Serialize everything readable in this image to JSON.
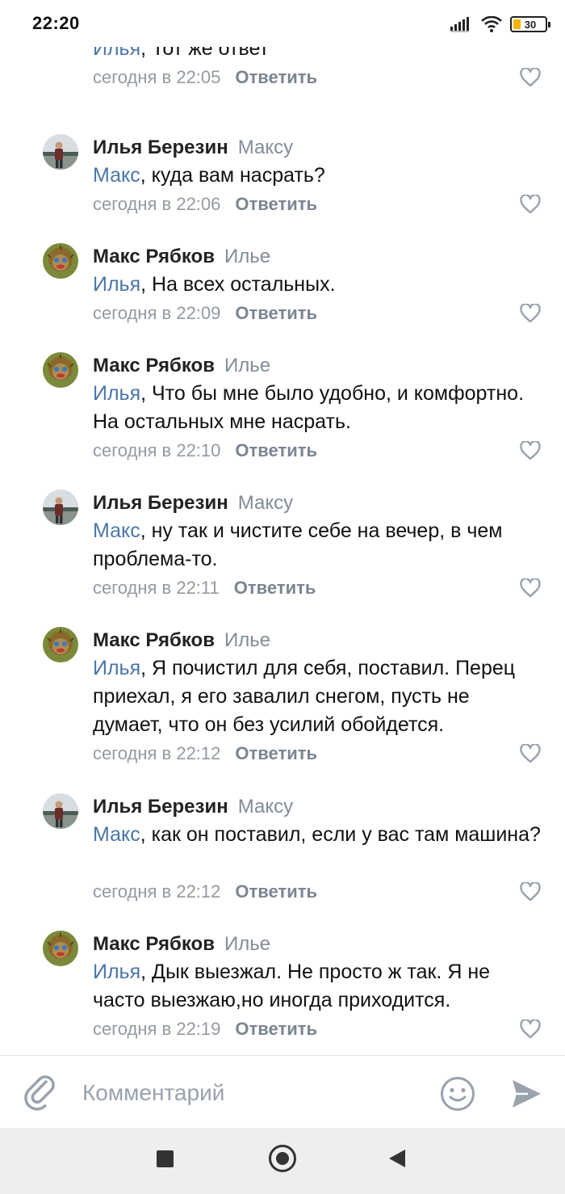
{
  "status_bar": {
    "time": "22:20",
    "battery": "30",
    "icons": [
      "signal-icon",
      "wifi-icon",
      "battery-icon"
    ]
  },
  "colors": {
    "mention": "#4a76a8",
    "secondary": "#818c99",
    "battery_fill": "#f5b400"
  },
  "comments": [
    {
      "author": "",
      "reply_to": "",
      "mention": "Илья",
      "text": ", Тот же ответ",
      "date": "сегодня в 22:05",
      "reply_label": "Ответить",
      "avatar": "maks"
    },
    {
      "author": "Илья Березин",
      "reply_to": "Максу",
      "mention": "Макс",
      "text": ", куда вам насрать?",
      "date": "сегодня в 22:06",
      "reply_label": "Ответить",
      "avatar": "ilya"
    },
    {
      "author": "Макс Рябков",
      "reply_to": "Илье",
      "mention": "Илья",
      "text": ", На всех остальных.",
      "date": "сегодня в 22:09",
      "reply_label": "Ответить",
      "avatar": "maks"
    },
    {
      "author": "Макс Рябков",
      "reply_to": "Илье",
      "mention": "Илья",
      "text": ", Что бы мне было удобно, и комфортно. На остальных мне насрать.",
      "date": "сегодня в 22:10",
      "reply_label": "Ответить",
      "avatar": "maks"
    },
    {
      "author": "Илья Березин",
      "reply_to": "Максу",
      "mention": "Макс",
      "text": ", ну так и чистите себе на вечер, в чем проблема-то.",
      "date": "сегодня в 22:11",
      "reply_label": "Ответить",
      "avatar": "ilya"
    },
    {
      "author": "Макс Рябков",
      "reply_to": "Илье",
      "mention": "Илья",
      "text": ", Я почистил для себя, поставил. Перец приехал, я его завалил снегом, пусть не думает, что он без усилий обойдется.",
      "date": "сегодня в 22:12",
      "reply_label": "Ответить",
      "avatar": "maks"
    },
    {
      "author": "Илья Березин",
      "reply_to": "Максу",
      "mention": "Макс",
      "text": ", как он поставил, если у вас там машина?",
      "date": "сегодня в 22:12",
      "reply_label": "Ответить",
      "avatar": "ilya"
    },
    {
      "author": "Макс Рябков",
      "reply_to": "Илье",
      "mention": "Илья",
      "text": ", Дык выезжал. Не просто ж так. Я не часто выезжаю,но иногда приходится.",
      "date": "сегодня в 22:19",
      "reply_label": "Ответить",
      "avatar": "maks"
    }
  ],
  "compose": {
    "placeholder": "Комментарий"
  },
  "nav_bar": {
    "buttons": [
      "recents-button",
      "home-button",
      "back-button"
    ]
  }
}
